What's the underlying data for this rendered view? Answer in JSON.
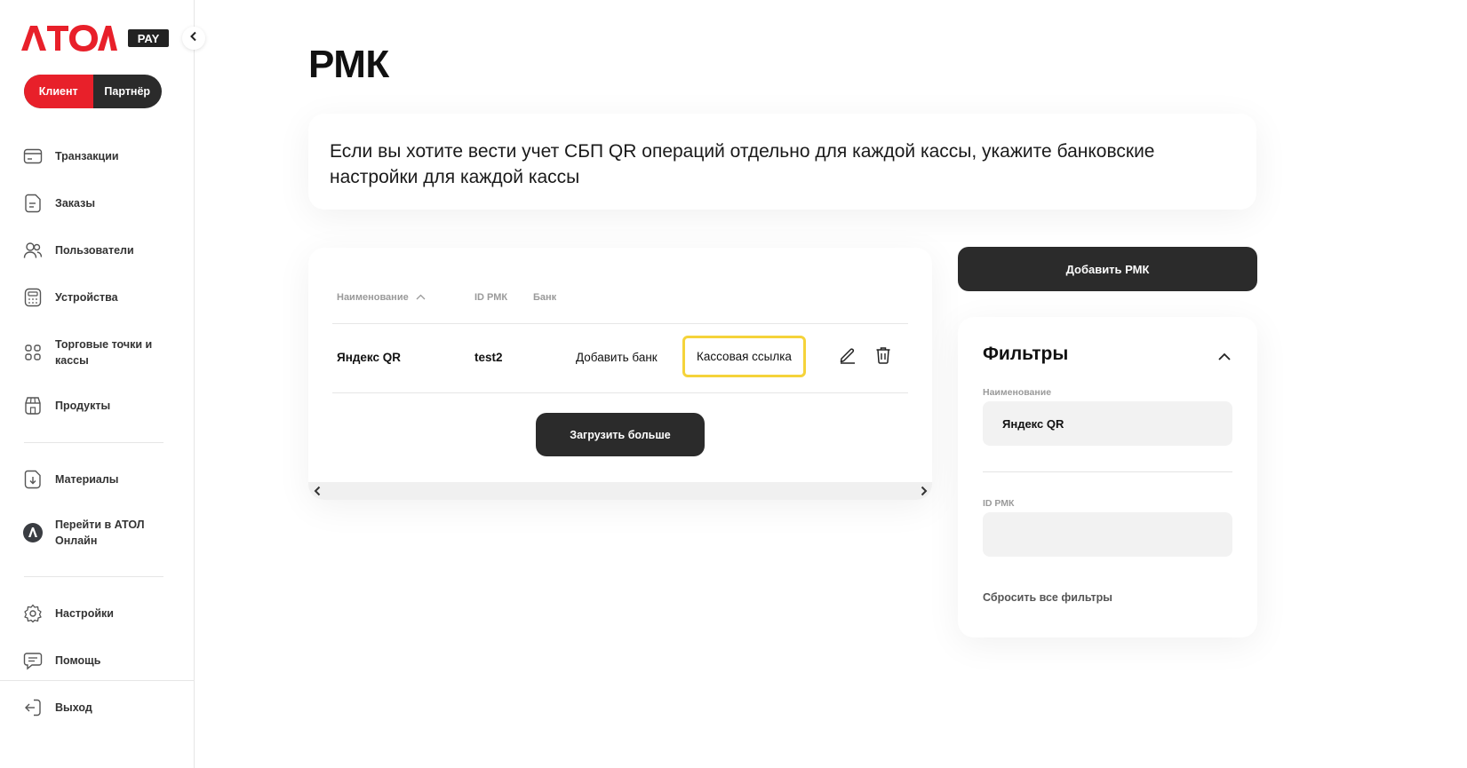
{
  "brand": {
    "logo_text": "ATOL",
    "pay_badge": "PAY",
    "accent": "#e8202a",
    "dark": "#2b2b2b",
    "highlight": "#f5d33a"
  },
  "role_switch": {
    "client": "Клиент",
    "partner": "Партнёр",
    "active": "client"
  },
  "sidebar": {
    "items": [
      {
        "label": "Транзакции",
        "icon": "card-icon"
      },
      {
        "label": "Заказы",
        "icon": "document-icon"
      },
      {
        "label": "Пользователи",
        "icon": "users-icon"
      },
      {
        "label": "Устройства",
        "icon": "calculator-icon"
      },
      {
        "label": "Торговые точки и кассы",
        "icon": "qr-scan-icon"
      },
      {
        "label": "Продукты",
        "icon": "store-icon"
      },
      {
        "label": "Материалы",
        "icon": "download-doc-icon"
      },
      {
        "label": "Перейти в АТОЛ Онлайн",
        "icon": "atol-online-icon"
      },
      {
        "label": "Настройки",
        "icon": "gear-icon"
      },
      {
        "label": "Помощь",
        "icon": "chat-icon"
      },
      {
        "label": "Выход",
        "icon": "logout-icon"
      }
    ]
  },
  "page": {
    "title": "РМК",
    "info": "Если вы хотите вести учет СБП QR операций отдельно для каждой кассы, укажите банковские настройки для каждой кассы"
  },
  "table": {
    "columns": {
      "name": "Наименование",
      "id": "ID РМК",
      "bank": "Банк"
    },
    "rows": [
      {
        "name": "Яндекс QR",
        "id": "test2",
        "bank": "Добавить банк",
        "link": "Кассовая ссылка"
      }
    ],
    "load_more": "Загрузить больше"
  },
  "actions": {
    "add": "Добавить РМК"
  },
  "filters": {
    "title": "Фильтры",
    "name_label": "Наименование",
    "name_value": "Яндекс QR",
    "id_label": "ID РМК",
    "id_value": "",
    "reset": "Сбросить все фильтры"
  }
}
